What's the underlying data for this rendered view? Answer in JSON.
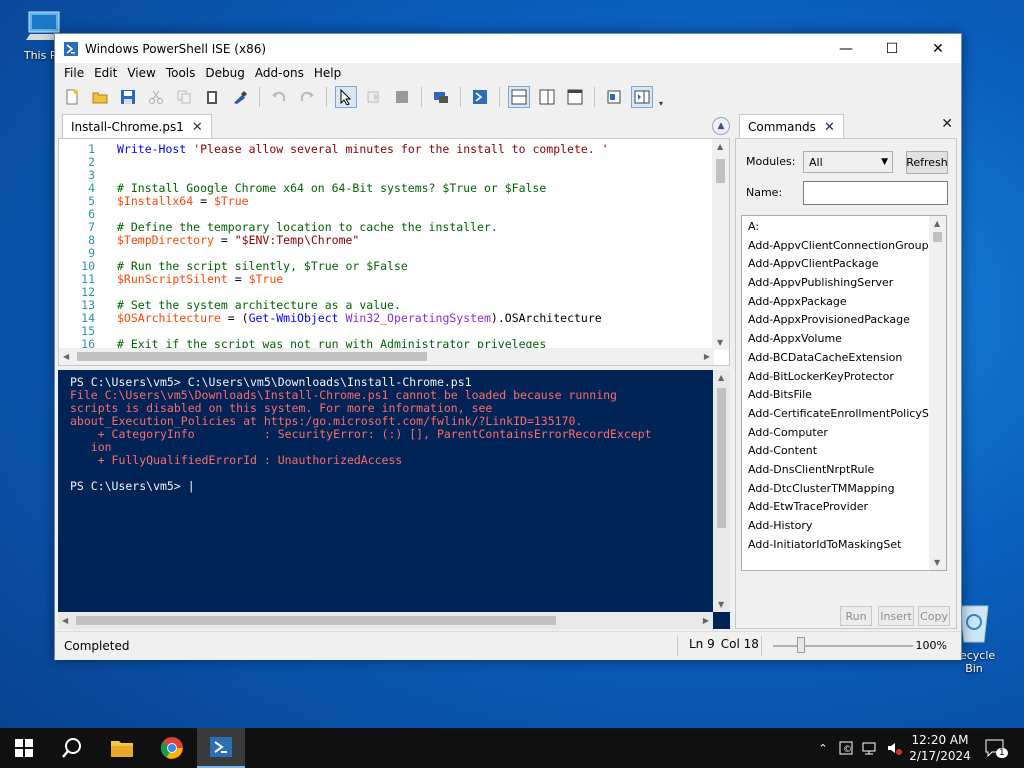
{
  "desktop": {
    "icons": [
      {
        "label": "This PC"
      },
      {
        "label": "Recycle Bin"
      }
    ]
  },
  "window": {
    "title": "Windows PowerShell ISE (x86)",
    "controls": {
      "minimize": "—",
      "maximize": "☐",
      "close": "✕"
    }
  },
  "menu": [
    "File",
    "Edit",
    "View",
    "Tools",
    "Debug",
    "Add-ons",
    "Help"
  ],
  "editor": {
    "tab_label": "Install-Chrome.ps1",
    "tab_close": "✕",
    "lines": [
      {
        "n": "1",
        "text": "Write-Host 'Please allow several minutes for the install to complete. '"
      },
      {
        "n": "2",
        "text": ""
      },
      {
        "n": "3",
        "text": ""
      },
      {
        "n": "4",
        "text": "# Install Google Chrome x64 on 64-Bit systems? $True or $False"
      },
      {
        "n": "5",
        "text": "$Installx64 = $True"
      },
      {
        "n": "6",
        "text": ""
      },
      {
        "n": "7",
        "text": "# Define the temporary location to cache the installer."
      },
      {
        "n": "8",
        "text": "$TempDirectory = \"$ENV:Temp\\Chrome\""
      },
      {
        "n": "9",
        "text": ""
      },
      {
        "n": "10",
        "text": "# Run the script silently, $True or $False"
      },
      {
        "n": "11",
        "text": "$RunScriptSilent = $True"
      },
      {
        "n": "12",
        "text": ""
      },
      {
        "n": "13",
        "text": "# Set the system architecture as a value."
      },
      {
        "n": "14",
        "text": "$OSArchitecture = (Get-WmiObject Win32_OperatingSystem).OSArchitecture"
      },
      {
        "n": "15",
        "text": ""
      },
      {
        "n": "16",
        "text": "# Exit if the script was not run with Administrator priveleges"
      }
    ]
  },
  "console": {
    "lines": [
      {
        "text": "PS C:\\Users\\vm5> C:\\Users\\vm5\\Downloads\\Install-Chrome.ps1",
        "kind": "white"
      },
      {
        "text": "File C:\\Users\\vm5\\Downloads\\Install-Chrome.ps1 cannot be loaded because running",
        "kind": "err"
      },
      {
        "text": "scripts is disabled on this system. For more information, see",
        "kind": "err"
      },
      {
        "text": "about_Execution_Policies at https:/go.microsoft.com/fwlink/?LinkID=135170.",
        "kind": "err"
      },
      {
        "text": "    + CategoryInfo          : SecurityError: (:) [], ParentContainsErrorRecordExcept",
        "kind": "err"
      },
      {
        "text": "   ion",
        "kind": "err"
      },
      {
        "text": "    + FullyQualifiedErrorId : UnauthorizedAccess",
        "kind": "err"
      },
      {
        "text": "",
        "kind": "white"
      },
      {
        "text": "PS C:\\Users\\vm5> |",
        "kind": "white"
      }
    ]
  },
  "commands": {
    "tab_label": "Commands",
    "tab_close": "✕",
    "pane_close": "✕",
    "modules_label": "Modules:",
    "modules_value": "All",
    "refresh_label": "Refresh",
    "name_label": "Name:",
    "name_value": "",
    "list": [
      "A:",
      "Add-AppvClientConnectionGroup",
      "Add-AppvClientPackage",
      "Add-AppvPublishingServer",
      "Add-AppxPackage",
      "Add-AppxProvisionedPackage",
      "Add-AppxVolume",
      "Add-BCDataCacheExtension",
      "Add-BitLockerKeyProtector",
      "Add-BitsFile",
      "Add-CertificateEnrollmentPolicyServer",
      "Add-Computer",
      "Add-Content",
      "Add-DnsClientNrptRule",
      "Add-DtcClusterTMMapping",
      "Add-EtwTraceProvider",
      "Add-History",
      "Add-InitiatorIdToMaskingSet"
    ],
    "run_label": "Run",
    "insert_label": "Insert",
    "copy_label": "Copy"
  },
  "status": {
    "text": "Completed",
    "line": "Ln 9",
    "col": "Col 18",
    "zoom": "100%",
    "zoom_fraction": 0.2
  },
  "taskbar": {
    "time": "12:20 AM",
    "date": "2/17/2024",
    "notification_count": "1"
  }
}
